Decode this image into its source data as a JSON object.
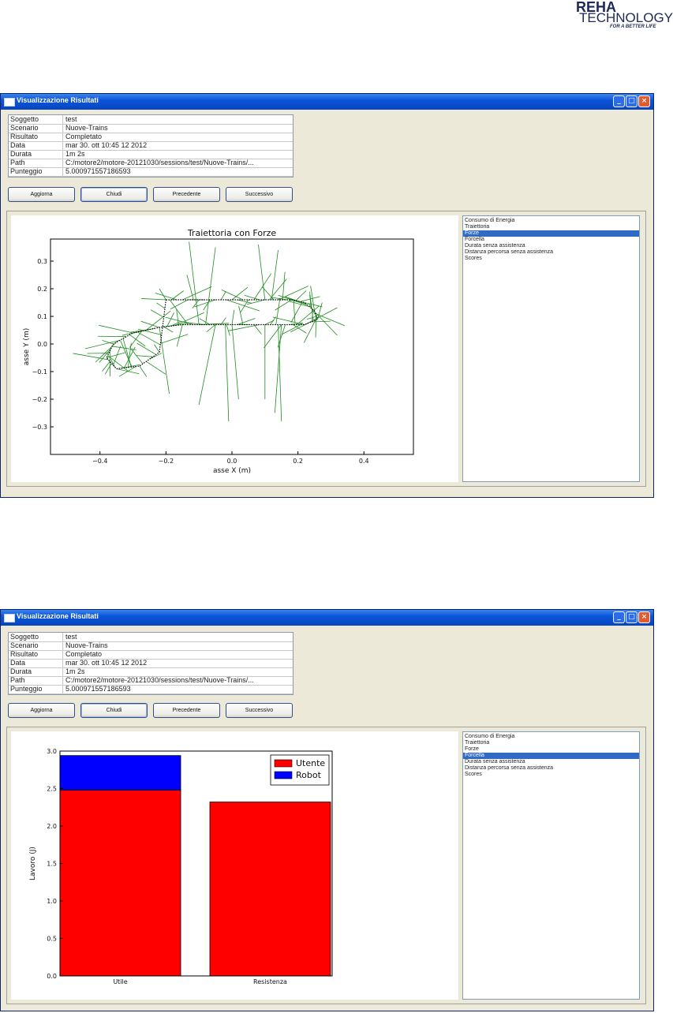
{
  "logo": {
    "line1": "REHA",
    "line2": "TECHNOLOGY",
    "line3": "FOR A BETTER LIFE"
  },
  "window_top": {
    "title": "Visualizzazione Risultati",
    "info": [
      {
        "key": "Soggetto",
        "value": "test"
      },
      {
        "key": "Scenario",
        "value": "Nuove-Trains"
      },
      {
        "key": "Risultato",
        "value": "Completato"
      },
      {
        "key": "Data",
        "value": "mar 30. ott 10:45 12 2012"
      },
      {
        "key": "Durata",
        "value": "1m 2s"
      },
      {
        "key": "Path",
        "value": "C:/motore2/motore-20121030/sessions/test/Nuove-Trains/..."
      },
      {
        "key": "Punteggio",
        "value": "5.000971557186593"
      }
    ],
    "buttons": {
      "refresh": "Aggiorna",
      "close": "Chiudi",
      "previous": "Precedente",
      "next": "Successivo"
    },
    "list": [
      "Consumo di Energia",
      "Traiettoria",
      "Forze",
      "Forcella",
      "Durata senza assistenza",
      "Distanza percorsa senza assistenza",
      "Scores"
    ],
    "selected_index": 2
  },
  "window_bottom": {
    "title": "Visualizzazione Risultati",
    "info": [
      {
        "key": "Soggetto",
        "value": "test"
      },
      {
        "key": "Scenario",
        "value": "Nuove-Trains"
      },
      {
        "key": "Risultato",
        "value": "Completato"
      },
      {
        "key": "Data",
        "value": "mar 30. ott 10:45 12 2012"
      },
      {
        "key": "Durata",
        "value": "1m 2s"
      },
      {
        "key": "Path",
        "value": "C:/motore2/motore-20121030/sessions/test/Nuove-Trains/..."
      },
      {
        "key": "Punteggio",
        "value": "5.000971557186593"
      }
    ],
    "buttons": {
      "refresh": "Aggiorna",
      "close": "Chiudi",
      "previous": "Precedente",
      "next": "Successivo"
    },
    "list": [
      "Consumo di Energia",
      "Traiettoria",
      "Forze",
      "Forcella",
      "Durata senza assistenza",
      "Distanza percorsa senza assistenza",
      "Scores"
    ],
    "selected_index": 3
  },
  "chart_data": [
    {
      "type": "line",
      "title": "Traiettoria con Forze",
      "xlabel": "asse X (m)",
      "ylabel": "asse Y (m)",
      "xlim": [
        -0.55,
        0.55
      ],
      "ylim": [
        -0.4,
        0.38
      ],
      "xticks": [
        -0.4,
        -0.2,
        0.0,
        0.2,
        0.4
      ],
      "yticks": [
        0.3,
        0.2,
        0.1,
        0.0,
        -0.1,
        -0.2,
        -0.3
      ],
      "series": [
        {
          "kind": "trajectory",
          "color": "#000000",
          "x": [
            -0.2,
            -0.1,
            0.0,
            0.1,
            0.18,
            0.22,
            0.25,
            0.26,
            0.22,
            0.15,
            0.05,
            -0.05,
            -0.15,
            -0.22,
            -0.3,
            -0.36,
            -0.38,
            -0.35,
            -0.28,
            -0.22,
            -0.2
          ],
          "y": [
            0.16,
            0.16,
            0.16,
            0.16,
            0.16,
            0.15,
            0.12,
            0.09,
            0.07,
            0.07,
            0.07,
            0.07,
            0.07,
            0.06,
            0.04,
            0.0,
            -0.05,
            -0.09,
            -0.08,
            -0.03,
            0.16
          ]
        },
        {
          "kind": "forces",
          "color": "#1e8c1e"
        }
      ]
    },
    {
      "type": "bar",
      "stacked": true,
      "categories": [
        "Utile",
        "Resistenza"
      ],
      "ylabel": "Lavoro (J)",
      "ylim": [
        0,
        3.0
      ],
      "yticks": [
        0.0,
        0.5,
        1.0,
        1.5,
        2.0,
        2.5,
        3.0
      ],
      "series": [
        {
          "name": "Utente",
          "color": "#ff0000",
          "values": [
            2.48,
            2.32
          ]
        },
        {
          "name": "Robot",
          "color": "#0000ff",
          "values": [
            0.46,
            0.0
          ]
        }
      ],
      "legend": "top-right"
    }
  ]
}
